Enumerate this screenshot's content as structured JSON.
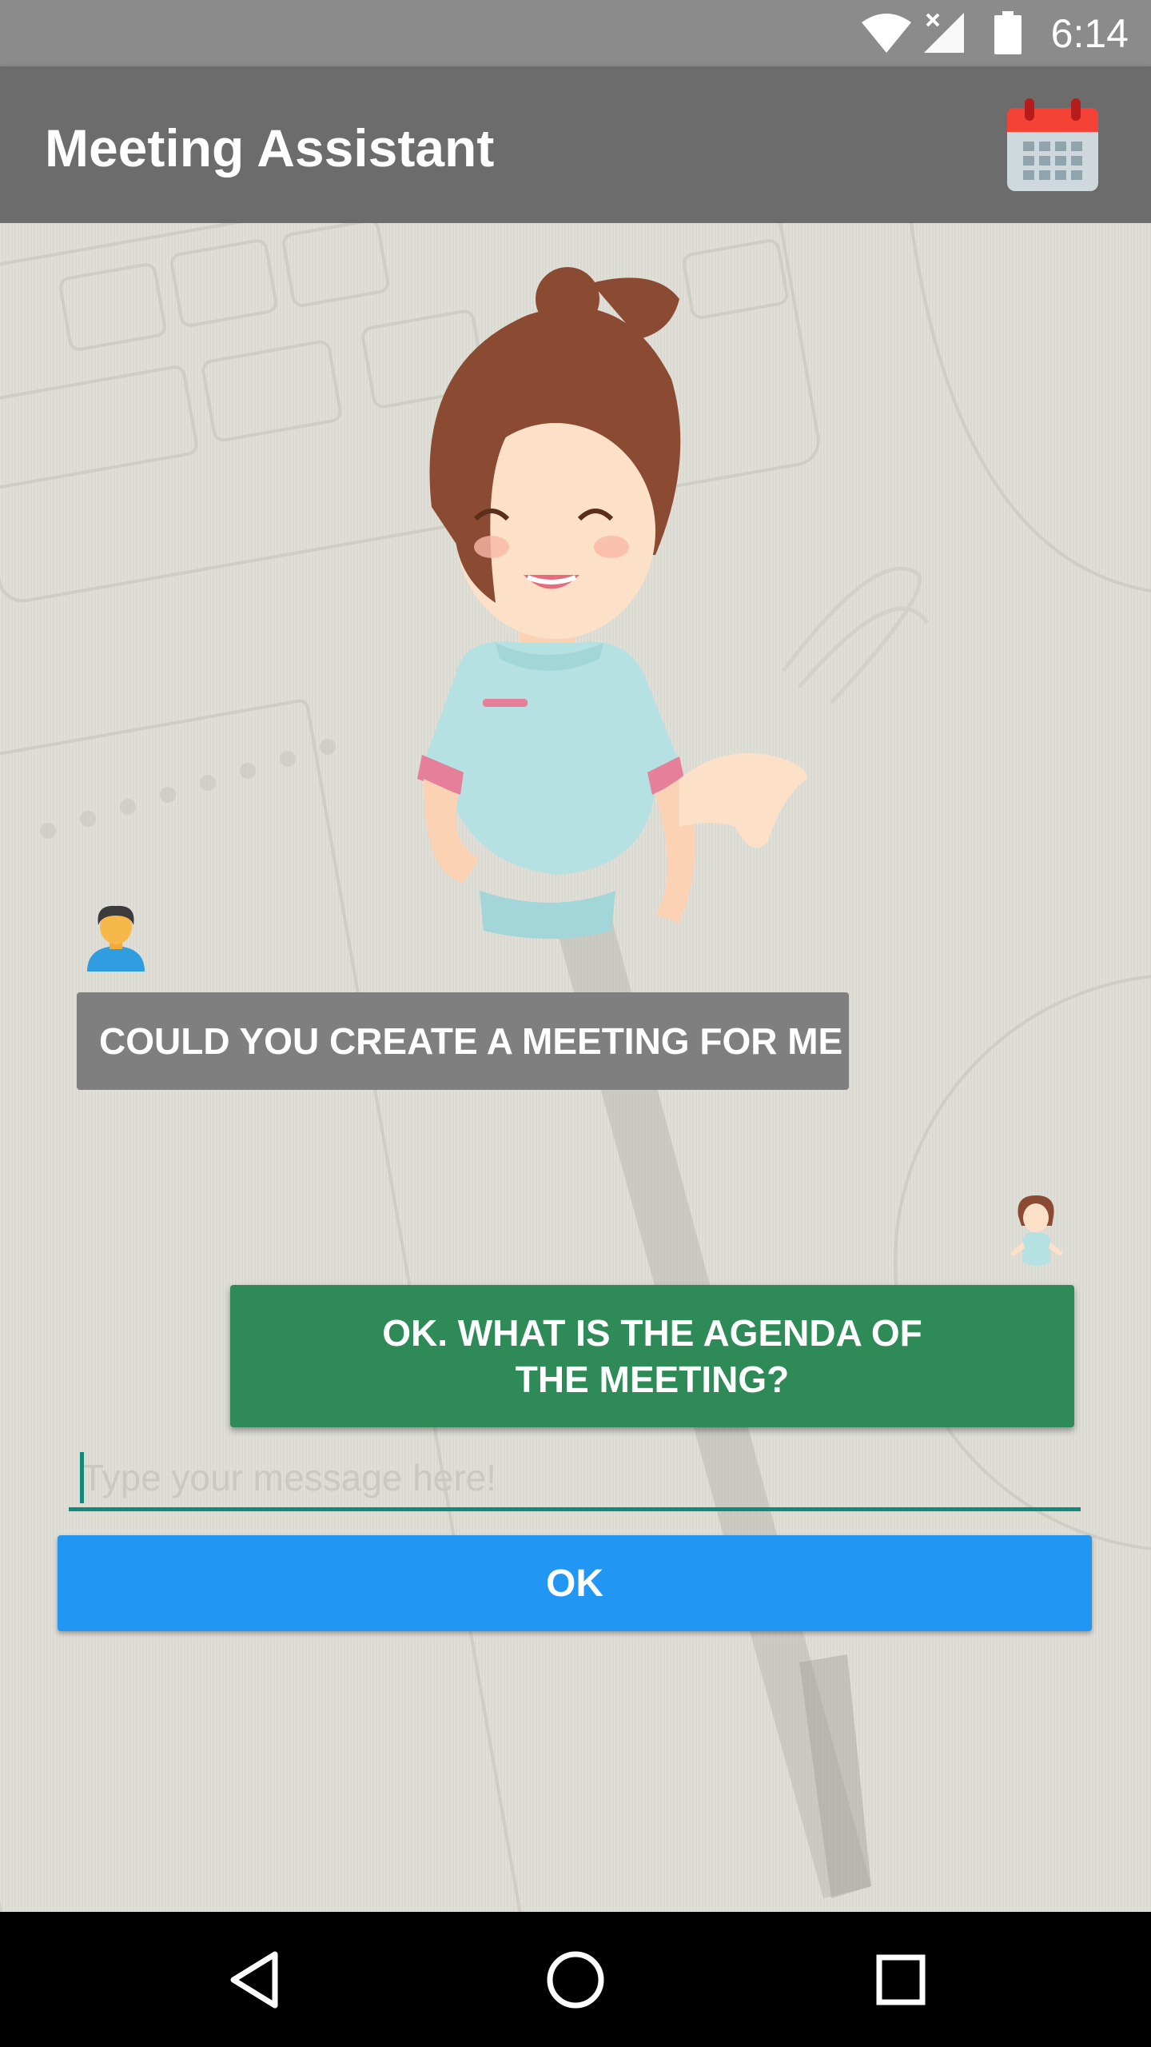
{
  "status_bar": {
    "time": "6:14",
    "icons": [
      "wifi-icon",
      "signal-off-icon",
      "battery-icon"
    ]
  },
  "app_bar": {
    "title": "Meeting Assistant",
    "action_icon": "calendar-icon",
    "colors": {
      "background": "#6c6c6c",
      "calendar_header": "#f44336",
      "calendar_body": "#cfd8dc"
    }
  },
  "chat": {
    "messages": [
      {
        "sender": "user",
        "avatar": "user-avatar-icon",
        "text": "COULD YOU CREATE A MEETING FOR ME",
        "color": "#7f7f7f"
      },
      {
        "sender": "assistant",
        "avatar": "assistant-avatar-icon",
        "text": "OK. WHAT IS THE AGENDA OF THE MEETING?",
        "color": "#2e8b57"
      }
    ]
  },
  "composer": {
    "placeholder": "Type your message here!",
    "value": "",
    "button_label": "OK",
    "accent": "#12897a",
    "button_color": "#2196f3"
  },
  "nav_bar": {
    "buttons": [
      "back-icon",
      "home-icon",
      "recents-icon"
    ]
  }
}
